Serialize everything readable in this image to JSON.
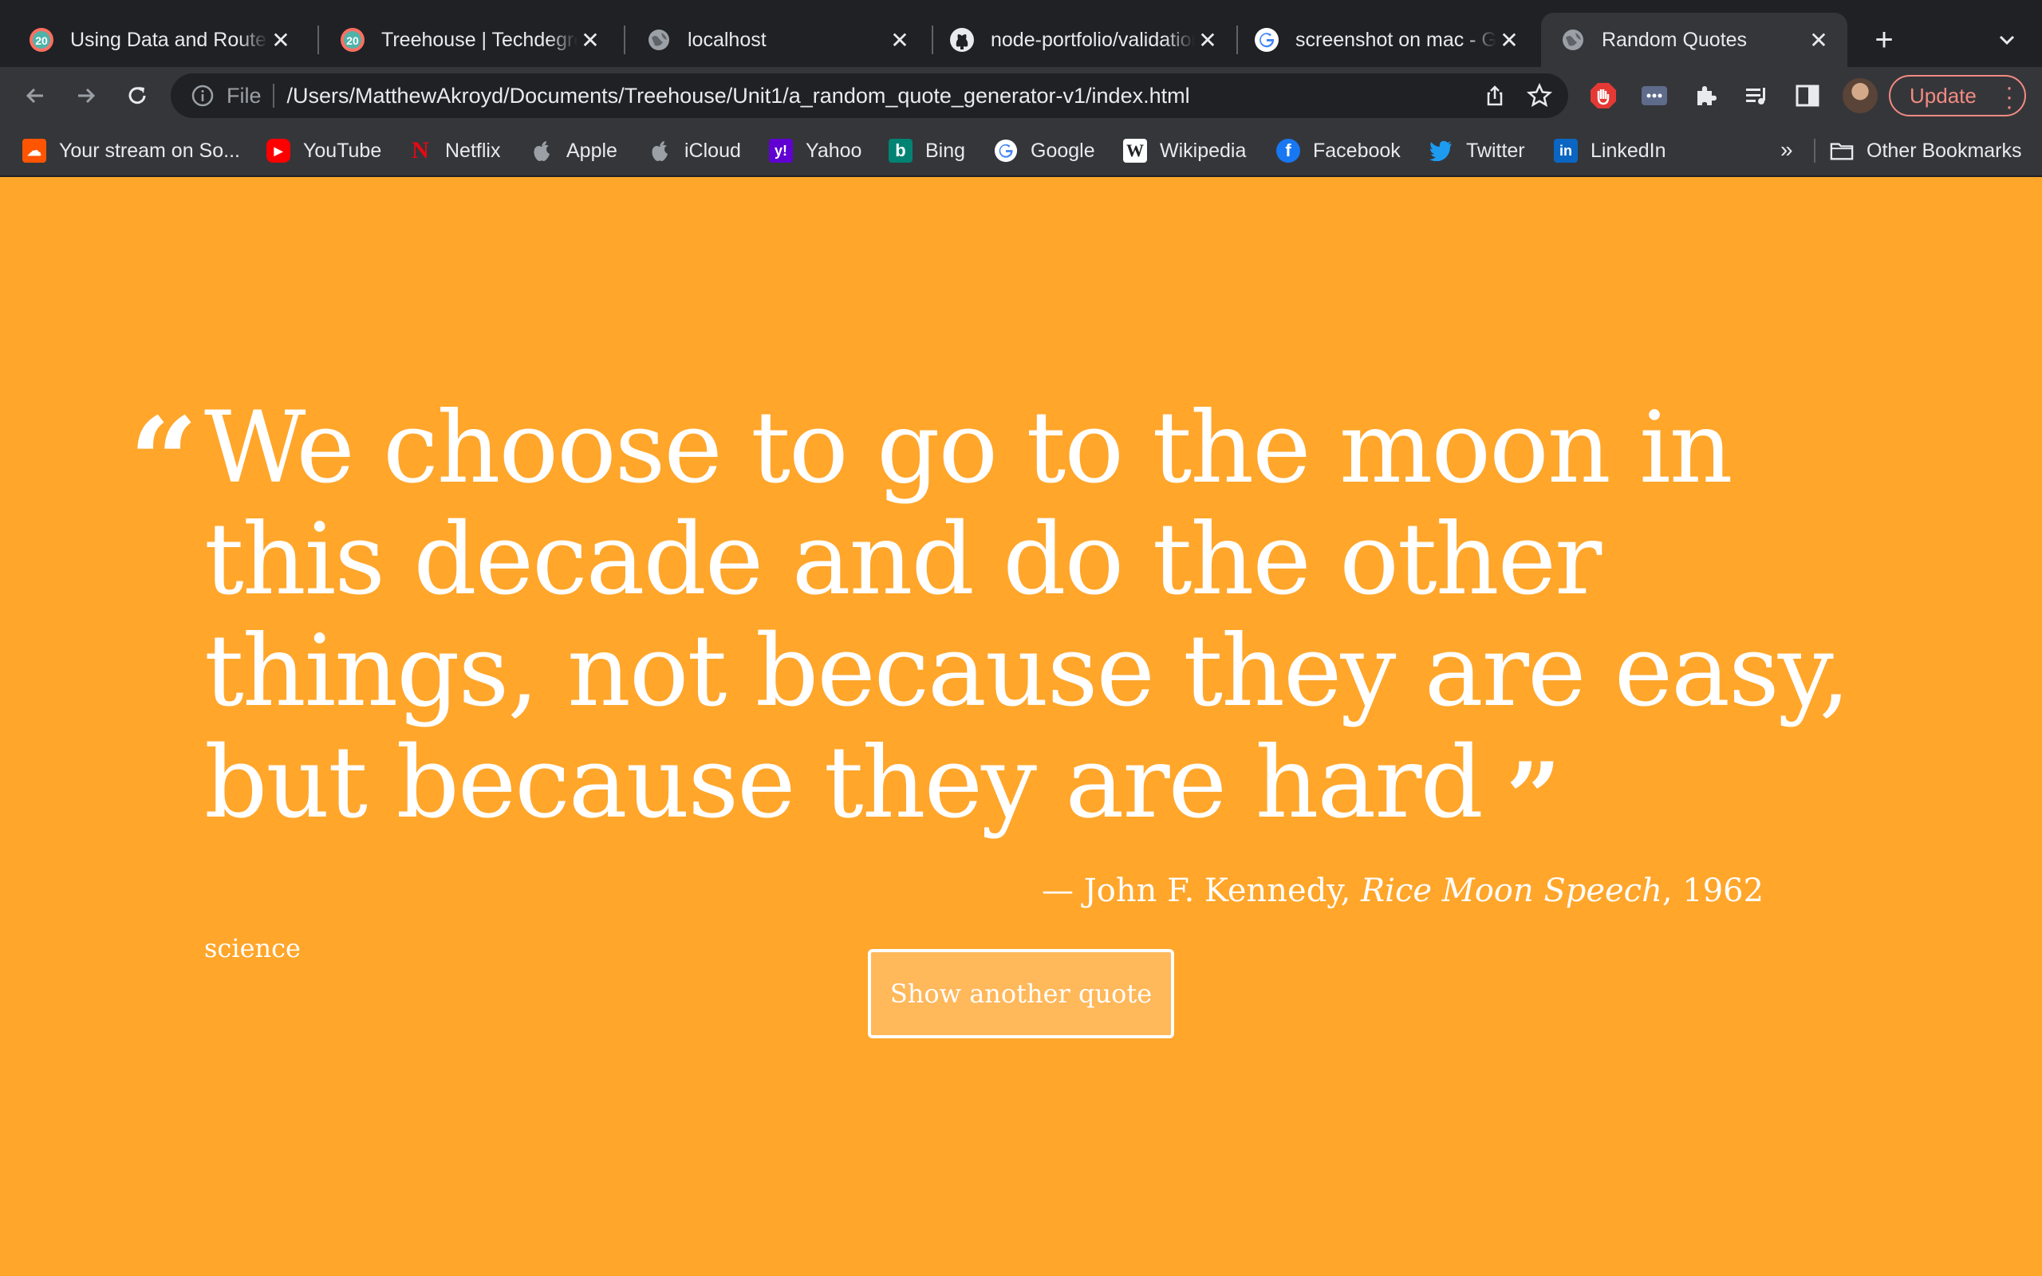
{
  "browser": {
    "tabs": [
      {
        "title": "Using Data and Route Pa",
        "favicon": "treehouse-20-icon"
      },
      {
        "title": "Treehouse | Techdegree",
        "favicon": "treehouse-20-icon"
      },
      {
        "title": "localhost",
        "favicon": "globe-icon"
      },
      {
        "title": "node-portfolio/validation",
        "favicon": "github-icon"
      },
      {
        "title": "screenshot on mac - Goo",
        "favicon": "google-icon"
      },
      {
        "title": "Random Quotes",
        "favicon": "globe-icon",
        "active": true
      }
    ],
    "omnibox": {
      "scheme_label": "File",
      "url": "/Users/MatthewAkroyd/Documents/Treehouse/Unit1/a_random_quote_generator-v1/index.html"
    },
    "update_label": "Update",
    "bookmarks": [
      {
        "label": "Your stream on So...",
        "icon": "soundcloud-icon",
        "color": "#ff5500"
      },
      {
        "label": "YouTube",
        "icon": "youtube-icon",
        "color": "#ff0000"
      },
      {
        "label": "Netflix",
        "icon": "netflix-icon",
        "color": "#e50914"
      },
      {
        "label": "Apple",
        "icon": "apple-icon",
        "color": "#9aa0a6"
      },
      {
        "label": "iCloud",
        "icon": "apple-icon",
        "color": "#9aa0a6"
      },
      {
        "label": "Yahoo",
        "icon": "yahoo-icon",
        "color": "#6001d2"
      },
      {
        "label": "Bing",
        "icon": "bing-icon",
        "color": "#008373"
      },
      {
        "label": "Google",
        "icon": "google-icon",
        "color": "#4285f4"
      },
      {
        "label": "Wikipedia",
        "icon": "wikipedia-icon",
        "color": "#ffffff"
      },
      {
        "label": "Facebook",
        "icon": "facebook-icon",
        "color": "#1877f2"
      },
      {
        "label": "Twitter",
        "icon": "twitter-icon",
        "color": "#1d9bf0"
      },
      {
        "label": "LinkedIn",
        "icon": "linkedin-icon",
        "color": "#0a66c2"
      }
    ],
    "more_bookmarks": "»",
    "other_bookmarks": "Other Bookmarks"
  },
  "page": {
    "background": "#ffa62b",
    "quote": "We choose to go to the moon in this decade and do the other things, not because they are easy, but because they are hard",
    "source_prefix": "— John F. Kennedy, ",
    "citation": "Rice Moon Speech",
    "year": ", 1962",
    "tag": "science",
    "button_label": "Show another quote"
  }
}
